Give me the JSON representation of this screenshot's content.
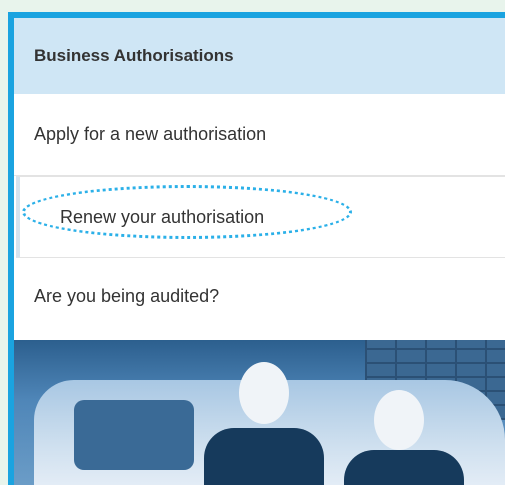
{
  "menu": {
    "header": "Business Authorisations",
    "items": [
      {
        "label": "Apply for a new authorisation"
      },
      {
        "label": "Renew your authorisation"
      },
      {
        "label": "Are you being audited?"
      }
    ]
  },
  "colors": {
    "accent": "#1aa3e0",
    "header_bg": "#cfe6f5",
    "highlight_ellipse": "#2bb0e8"
  },
  "icons": [
    "dotted-highlight-ellipse"
  ]
}
